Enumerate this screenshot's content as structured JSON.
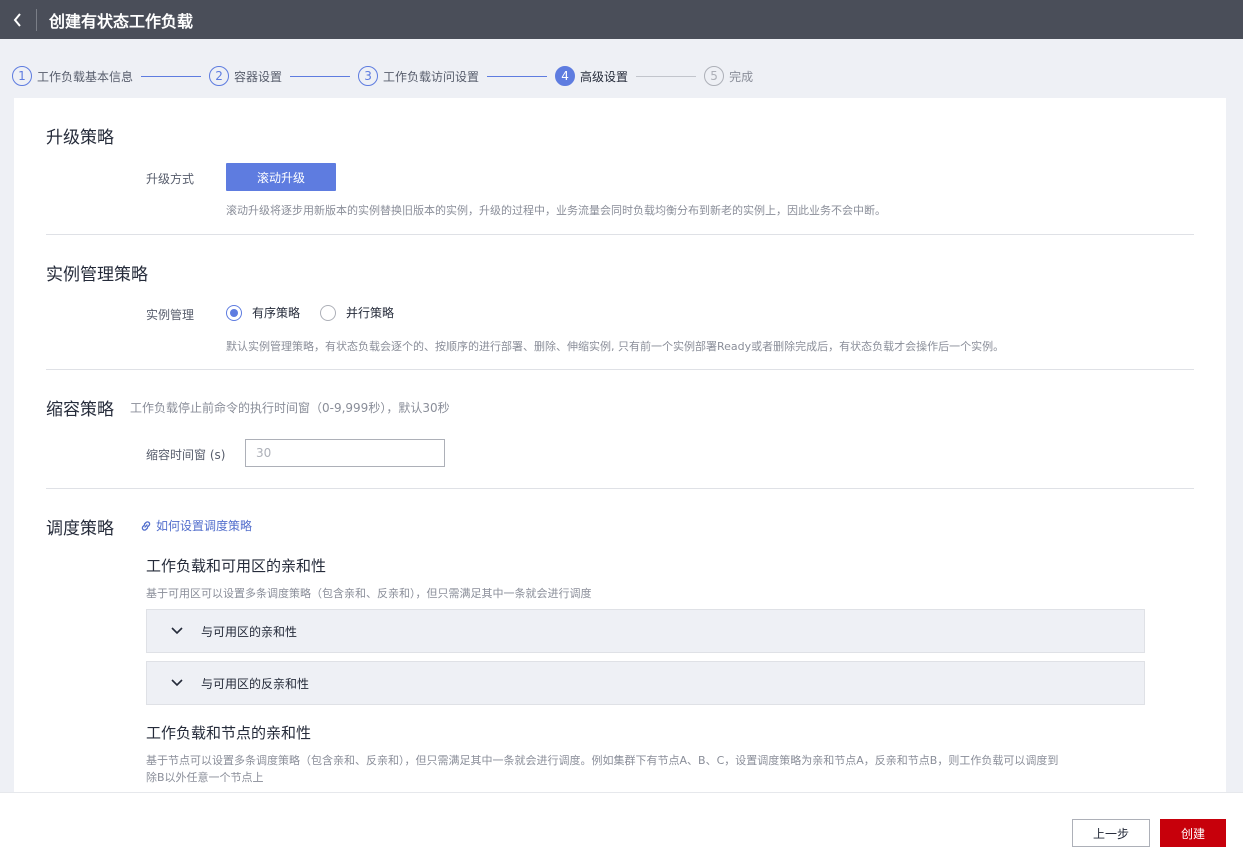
{
  "header": {
    "title": "创建有状态工作负载"
  },
  "steps": [
    {
      "num": "1",
      "label": "工作负载基本信息"
    },
    {
      "num": "2",
      "label": "容器设置"
    },
    {
      "num": "3",
      "label": "工作负载访问设置"
    },
    {
      "num": "4",
      "label": "高级设置"
    },
    {
      "num": "5",
      "label": "完成"
    }
  ],
  "upgrade": {
    "title": "升级策略",
    "method_label": "升级方式",
    "method_value": "滚动升级",
    "help": "滚动升级将逐步用新版本的实例替换旧版本的实例，升级的过程中，业务流量会同时负载均衡分布到新老的实例上，因此业务不会中断。"
  },
  "instance": {
    "title": "实例管理策略",
    "label": "实例管理",
    "options": [
      "有序策略",
      "并行策略"
    ],
    "selected": "有序策略",
    "help": "默认实例管理策略，有状态负载会逐个的、按顺序的进行部署、删除、伸缩实例, 只有前一个实例部署Ready或者删除完成后，有状态负载才会操作后一个实例。"
  },
  "scale_in": {
    "title": "缩容策略",
    "desc": "工作负载停止前命令的执行时间窗（0-9,999秒），默认30秒",
    "label": "缩容时间窗 (s)",
    "placeholder": "30"
  },
  "scheduling": {
    "title": "调度策略",
    "link": "如何设置调度策略",
    "az_affinity": {
      "title": "工作负载和可用区的亲和性",
      "desc": "基于可用区可以设置多条调度策略（包含亲和、反亲和），但只需满足其中一条就会进行调度",
      "panels": [
        "与可用区的亲和性",
        "与可用区的反亲和性"
      ]
    },
    "node_affinity": {
      "title": "工作负载和节点的亲和性",
      "desc_line1": "基于节点可以设置多条调度策略（包含亲和、反亲和），但只需满足其中一条就会进行调度。例如集群下有节点A、B、C，设置调度策略为亲和节点A，反亲和节点B，则工作负载可以调度到",
      "desc_line2": "除B以外任意一个节点上"
    }
  },
  "footer": {
    "prev": "上一步",
    "create": "创建"
  },
  "colors": {
    "primary": "#5e7ce0",
    "danger": "#c7000b",
    "header_bg": "#4a4e59"
  }
}
